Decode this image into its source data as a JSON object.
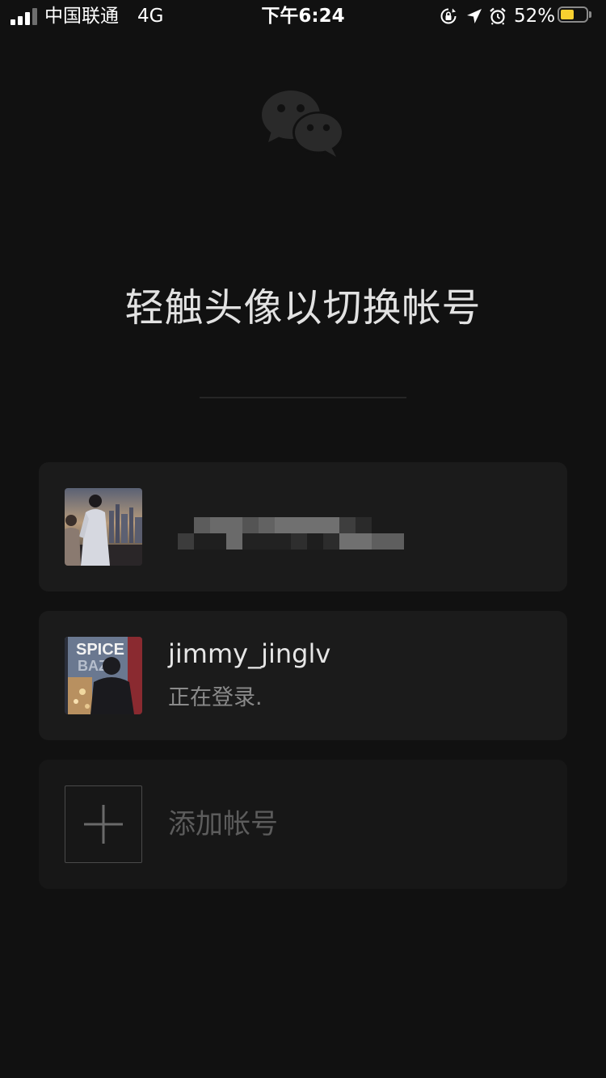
{
  "status_bar": {
    "carrier": "中国联通",
    "network": "4G",
    "time": "下午6:24",
    "battery_percent": "52%",
    "battery_level": 0.52,
    "battery_color": "#f8d030",
    "icons": [
      "signal-icon",
      "orientation-lock-icon",
      "location-arrow-icon",
      "alarm-icon",
      "battery-icon"
    ]
  },
  "logo": {
    "icon": "wechat-logo-icon"
  },
  "header": {
    "title": "轻触头像以切换帐号"
  },
  "accounts": [
    {
      "avatar": "avatar-photo",
      "name": "",
      "status": ""
    },
    {
      "avatar": "avatar-photo",
      "name": "jimmy_jinglv",
      "status": "正在登录."
    }
  ],
  "add_account": {
    "icon": "plus-icon",
    "label": "添加帐号"
  }
}
